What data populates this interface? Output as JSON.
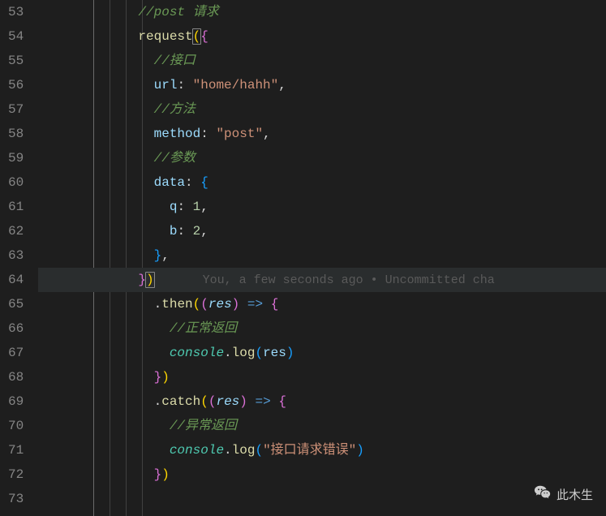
{
  "editor": {
    "startLine": 53,
    "endLine": 73,
    "highlightedLine": 64,
    "gitlens": "You, a few seconds ago • Uncommitted cha",
    "lines": [
      {
        "n": 53,
        "tokens": [
          {
            "t": "            ",
            "c": "default"
          },
          {
            "t": "//post 请求",
            "c": "comment"
          }
        ]
      },
      {
        "n": 54,
        "tokens": [
          {
            "t": "            ",
            "c": "default"
          },
          {
            "t": "request",
            "c": "func"
          },
          {
            "t": "(",
            "c": "bracket-y",
            "match": true
          },
          {
            "t": "{",
            "c": "bracket-p"
          }
        ]
      },
      {
        "n": 55,
        "tokens": [
          {
            "t": "              ",
            "c": "default"
          },
          {
            "t": "//接口",
            "c": "comment"
          }
        ]
      },
      {
        "n": 56,
        "tokens": [
          {
            "t": "              ",
            "c": "default"
          },
          {
            "t": "url",
            "c": "prop"
          },
          {
            "t": ": ",
            "c": "default"
          },
          {
            "t": "\"home/hahh\"",
            "c": "string"
          },
          {
            "t": ",",
            "c": "default"
          }
        ]
      },
      {
        "n": 57,
        "tokens": [
          {
            "t": "              ",
            "c": "default"
          },
          {
            "t": "//方法",
            "c": "comment"
          }
        ]
      },
      {
        "n": 58,
        "tokens": [
          {
            "t": "              ",
            "c": "default"
          },
          {
            "t": "method",
            "c": "prop"
          },
          {
            "t": ": ",
            "c": "default"
          },
          {
            "t": "\"post\"",
            "c": "string"
          },
          {
            "t": ",",
            "c": "default"
          }
        ]
      },
      {
        "n": 59,
        "tokens": [
          {
            "t": "              ",
            "c": "default"
          },
          {
            "t": "//参数",
            "c": "comment"
          }
        ]
      },
      {
        "n": 60,
        "tokens": [
          {
            "t": "              ",
            "c": "default"
          },
          {
            "t": "data",
            "c": "prop"
          },
          {
            "t": ": ",
            "c": "default"
          },
          {
            "t": "{",
            "c": "bracket-b"
          }
        ]
      },
      {
        "n": 61,
        "tokens": [
          {
            "t": "                ",
            "c": "default"
          },
          {
            "t": "q",
            "c": "prop"
          },
          {
            "t": ": ",
            "c": "default"
          },
          {
            "t": "1",
            "c": "num"
          },
          {
            "t": ",",
            "c": "default"
          }
        ]
      },
      {
        "n": 62,
        "tokens": [
          {
            "t": "                ",
            "c": "default"
          },
          {
            "t": "b",
            "c": "prop"
          },
          {
            "t": ": ",
            "c": "default"
          },
          {
            "t": "2",
            "c": "num"
          },
          {
            "t": ",",
            "c": "default"
          }
        ]
      },
      {
        "n": 63,
        "tokens": [
          {
            "t": "              ",
            "c": "default"
          },
          {
            "t": "}",
            "c": "bracket-b"
          },
          {
            "t": ",",
            "c": "default"
          }
        ]
      },
      {
        "n": 64,
        "tokens": [
          {
            "t": "            ",
            "c": "default"
          },
          {
            "t": "}",
            "c": "bracket-p"
          },
          {
            "t": ")",
            "c": "bracket-y",
            "match": true
          }
        ],
        "gitlens": true
      },
      {
        "n": 65,
        "tokens": [
          {
            "t": "              ",
            "c": "default"
          },
          {
            "t": ".",
            "c": "default"
          },
          {
            "t": "then",
            "c": "func"
          },
          {
            "t": "(",
            "c": "bracket-y"
          },
          {
            "t": "(",
            "c": "bracket-p"
          },
          {
            "t": "res",
            "c": "param"
          },
          {
            "t": ")",
            "c": "bracket-p"
          },
          {
            "t": " ",
            "c": "default"
          },
          {
            "t": "=>",
            "c": "arrow"
          },
          {
            "t": " ",
            "c": "default"
          },
          {
            "t": "{",
            "c": "bracket-p"
          }
        ]
      },
      {
        "n": 66,
        "tokens": [
          {
            "t": "                ",
            "c": "default"
          },
          {
            "t": "//正常返回",
            "c": "comment"
          }
        ]
      },
      {
        "n": 67,
        "tokens": [
          {
            "t": "                ",
            "c": "default"
          },
          {
            "t": "console",
            "c": "obj"
          },
          {
            "t": ".",
            "c": "default"
          },
          {
            "t": "log",
            "c": "func"
          },
          {
            "t": "(",
            "c": "bracket-b"
          },
          {
            "t": "res",
            "c": "prop"
          },
          {
            "t": ")",
            "c": "bracket-b"
          }
        ]
      },
      {
        "n": 68,
        "tokens": [
          {
            "t": "              ",
            "c": "default"
          },
          {
            "t": "}",
            "c": "bracket-p"
          },
          {
            "t": ")",
            "c": "bracket-y"
          }
        ]
      },
      {
        "n": 69,
        "tokens": [
          {
            "t": "              ",
            "c": "default"
          },
          {
            "t": ".",
            "c": "default"
          },
          {
            "t": "catch",
            "c": "func"
          },
          {
            "t": "(",
            "c": "bracket-y"
          },
          {
            "t": "(",
            "c": "bracket-p"
          },
          {
            "t": "res",
            "c": "param"
          },
          {
            "t": ")",
            "c": "bracket-p"
          },
          {
            "t": " ",
            "c": "default"
          },
          {
            "t": "=>",
            "c": "arrow"
          },
          {
            "t": " ",
            "c": "default"
          },
          {
            "t": "{",
            "c": "bracket-p"
          }
        ]
      },
      {
        "n": 70,
        "tokens": [
          {
            "t": "                ",
            "c": "default"
          },
          {
            "t": "//异常返回",
            "c": "comment"
          }
        ]
      },
      {
        "n": 71,
        "tokens": [
          {
            "t": "                ",
            "c": "default"
          },
          {
            "t": "console",
            "c": "obj"
          },
          {
            "t": ".",
            "c": "default"
          },
          {
            "t": "log",
            "c": "func"
          },
          {
            "t": "(",
            "c": "bracket-b"
          },
          {
            "t": "\"接口请求错误\"",
            "c": "string"
          },
          {
            "t": ")",
            "c": "bracket-b"
          }
        ]
      },
      {
        "n": 72,
        "tokens": [
          {
            "t": "              ",
            "c": "default"
          },
          {
            "t": "}",
            "c": "bracket-p"
          },
          {
            "t": ")",
            "c": "bracket-y"
          }
        ]
      },
      {
        "n": 73,
        "tokens": []
      }
    ]
  },
  "watermark": {
    "label": "此木生"
  }
}
